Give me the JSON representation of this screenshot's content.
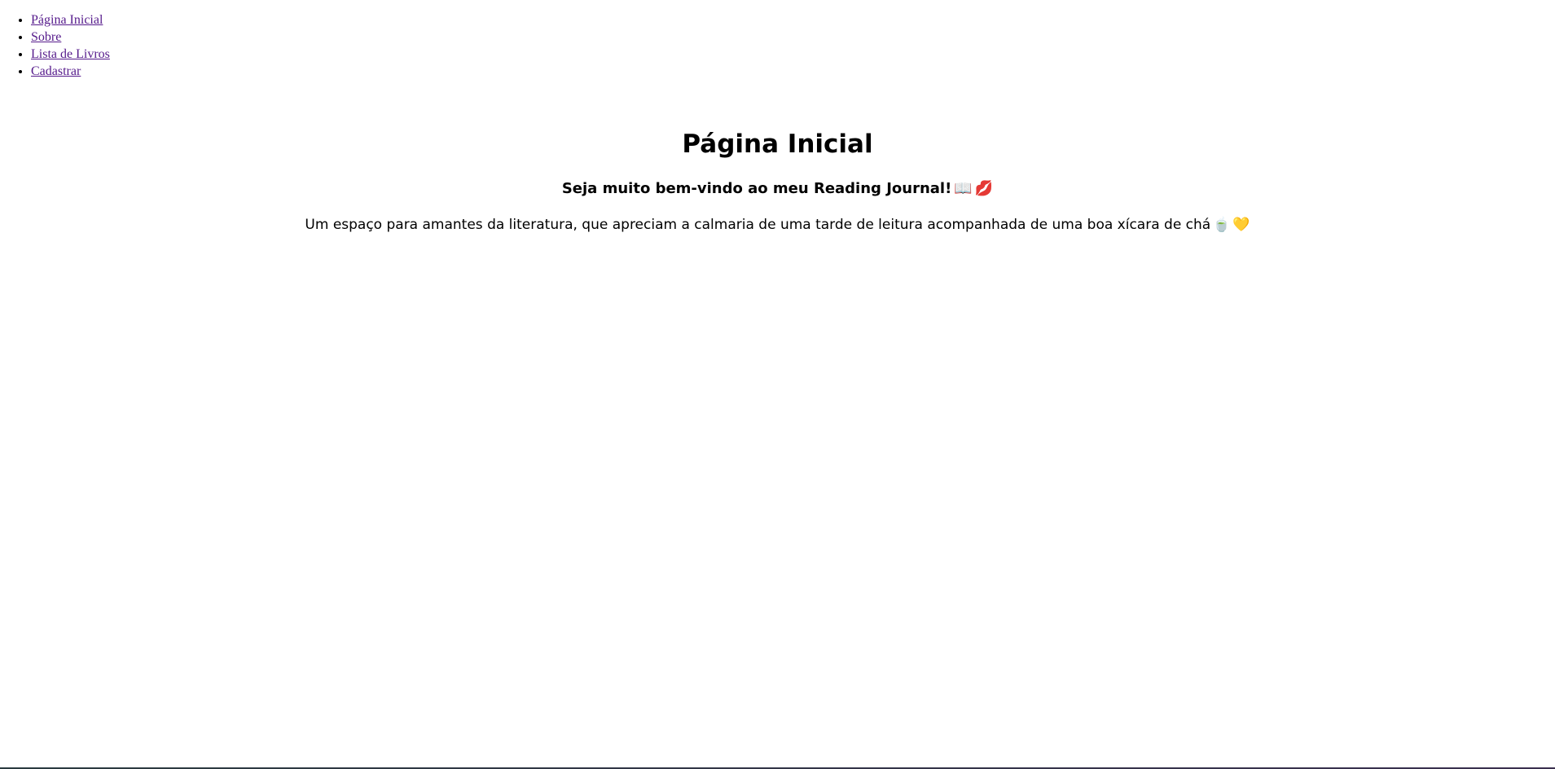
{
  "nav": {
    "items": [
      {
        "label": "Página Inicial"
      },
      {
        "label": "Sobre"
      },
      {
        "label": "Lista de Livros"
      },
      {
        "label": "Cadastrar"
      }
    ]
  },
  "main": {
    "title": "Página Inicial",
    "welcome_text": "Seja muito bem-vindo ao meu Reading Journal!",
    "welcome_emojis": [
      "📖",
      "💋"
    ],
    "description_text": "Um espaço para amantes da literatura, que apreciam a calmaria de uma tarde de leitura acompanhada de uma boa xícara de chá",
    "description_emojis": [
      "🍵",
      "💛"
    ]
  },
  "colors": {
    "link_visited": "#551a8b",
    "text": "#000000",
    "background": "#ffffff"
  }
}
